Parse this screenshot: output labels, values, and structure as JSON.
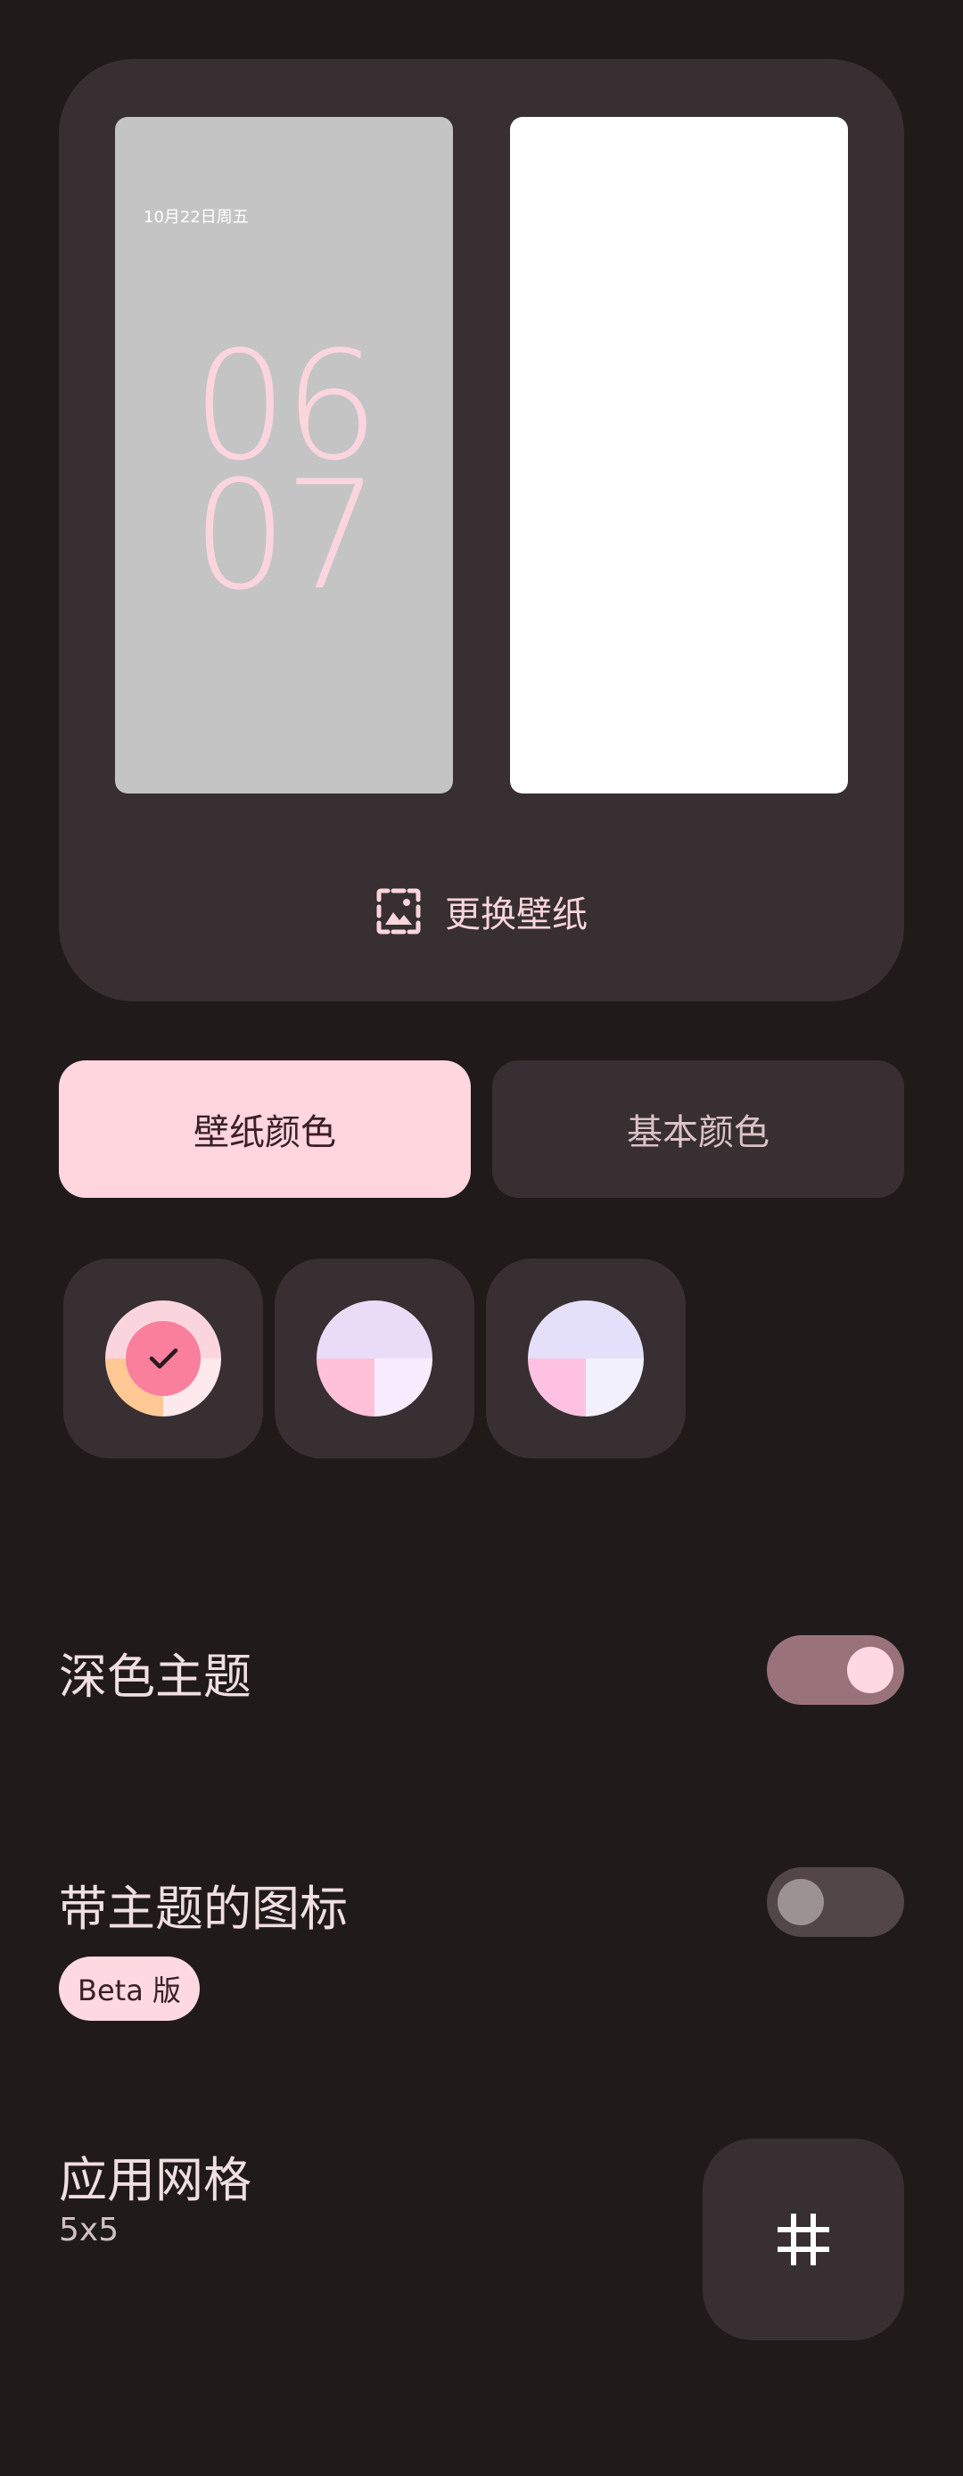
{
  "preview": {
    "lock_date": "10月22日周五",
    "clock_hours": "06",
    "clock_minutes": "07",
    "change_wallpaper_label": "更换壁纸",
    "change_wallpaper_icon": "wallpaper-icon"
  },
  "color_tabs": {
    "wallpaper_colors": "壁纸颜色",
    "basic_colors": "基本颜色"
  },
  "swatches": [
    {
      "top": "#fbd5de",
      "bottom_left": "#ffc894",
      "bottom_right": "#fde8ec",
      "center": "#f97f9d",
      "selected": true
    },
    {
      "top": "#eadcf6",
      "bottom_left": "#ffc1d8",
      "bottom_right": "#f6ecfe",
      "selected": false
    },
    {
      "top": "#e4e0f9",
      "bottom_left": "#ffc1e2",
      "bottom_right": "#f3f0fe",
      "selected": false
    }
  ],
  "dark_theme": {
    "label": "深色主题",
    "enabled": true
  },
  "themed_icons": {
    "label": "带主题的图标",
    "badge": "Beta 版",
    "enabled": false
  },
  "app_grid": {
    "label": "应用网格",
    "value": "5x5",
    "icon": "grid-icon"
  },
  "colors": {
    "background": "#201a1b",
    "surface": "#372f31",
    "accent": "#ffd5de"
  }
}
